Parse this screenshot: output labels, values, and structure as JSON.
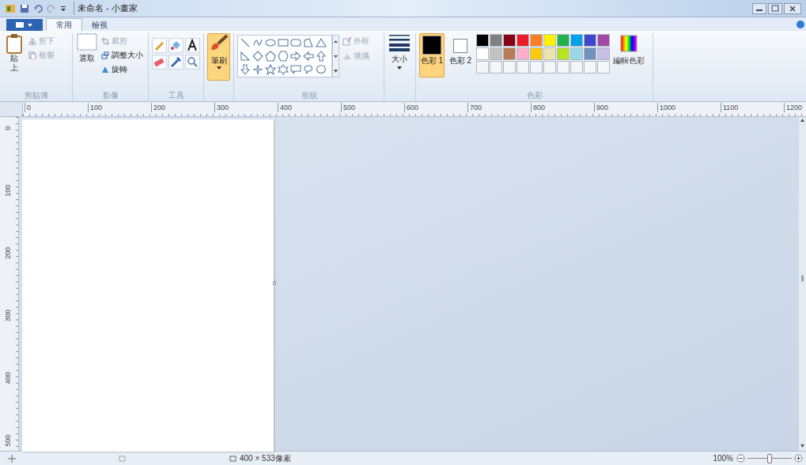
{
  "window": {
    "title": "未命名 - 小畫家"
  },
  "tabs": [
    {
      "label": "常用",
      "selected": true
    },
    {
      "label": "檢視",
      "selected": false
    }
  ],
  "ribbon": {
    "clipboard": {
      "label": "剪貼簿",
      "paste": "貼上",
      "items": [
        {
          "label": "剪下",
          "disabled": true
        },
        {
          "label": "複製",
          "disabled": true
        }
      ]
    },
    "image": {
      "label": "影像",
      "select": "選取",
      "items": [
        {
          "label": "裁剪",
          "disabled": true
        },
        {
          "label": "調整大小",
          "disabled": false
        },
        {
          "label": "旋轉",
          "disabled": false
        }
      ]
    },
    "tools": {
      "label": "工具"
    },
    "brush": {
      "label": "筆刷",
      "selected": true
    },
    "shapes": {
      "label": "形狀",
      "options": [
        {
          "label": "外框",
          "disabled": true
        },
        {
          "label": "填滿",
          "disabled": true
        }
      ]
    },
    "size": {
      "label": "大小"
    },
    "colors": {
      "label": "色彩",
      "current": [
        {
          "label": "色彩 1",
          "color": "#000000",
          "selected": true
        },
        {
          "label": "色彩 2",
          "color": "#ffffff",
          "selected": false
        }
      ],
      "palette": [
        {
          "kind": "color",
          "color": "#000000"
        },
        {
          "kind": "color",
          "color": "#7f7f7f"
        },
        {
          "kind": "color",
          "color": "#880015"
        },
        {
          "kind": "color",
          "color": "#ed1c24"
        },
        {
          "kind": "color",
          "color": "#ff7f27"
        },
        {
          "kind": "color",
          "color": "#fff200"
        },
        {
          "kind": "color",
          "color": "#22b14c"
        },
        {
          "kind": "color",
          "color": "#00a2e8"
        },
        {
          "kind": "color",
          "color": "#3f48cc"
        },
        {
          "kind": "color",
          "color": "#a349a4"
        },
        {
          "kind": "color",
          "color": "#ffffff"
        },
        {
          "kind": "color",
          "color": "#c3c3c3"
        },
        {
          "kind": "color",
          "color": "#b97a57"
        },
        {
          "kind": "color",
          "color": "#ffaec9"
        },
        {
          "kind": "color",
          "color": "#ffc90e"
        },
        {
          "kind": "color",
          "color": "#efe4b0"
        },
        {
          "kind": "color",
          "color": "#b5e61d"
        },
        {
          "kind": "color",
          "color": "#99d9ea"
        },
        {
          "kind": "color",
          "color": "#7092be"
        },
        {
          "kind": "color",
          "color": "#c8bfe7"
        },
        {
          "kind": "empty"
        },
        {
          "kind": "empty"
        },
        {
          "kind": "empty"
        },
        {
          "kind": "empty"
        },
        {
          "kind": "empty"
        },
        {
          "kind": "empty"
        },
        {
          "kind": "empty"
        },
        {
          "kind": "empty"
        },
        {
          "kind": "empty"
        },
        {
          "kind": "empty"
        }
      ],
      "edit": "編輯色彩"
    }
  },
  "ruler": {
    "horizontal": [
      "0",
      "100",
      "200",
      "300",
      "400",
      "500",
      "600",
      "700",
      "800",
      "900",
      "1000",
      "1100",
      "1200"
    ],
    "vertical": [
      "0",
      "100",
      "200",
      "300",
      "400",
      "500"
    ]
  },
  "status_bar": {
    "canvas_size": "400 × 533像素",
    "zoom": "100%",
    "zoom_slider": {
      "level": 0.5
    }
  }
}
